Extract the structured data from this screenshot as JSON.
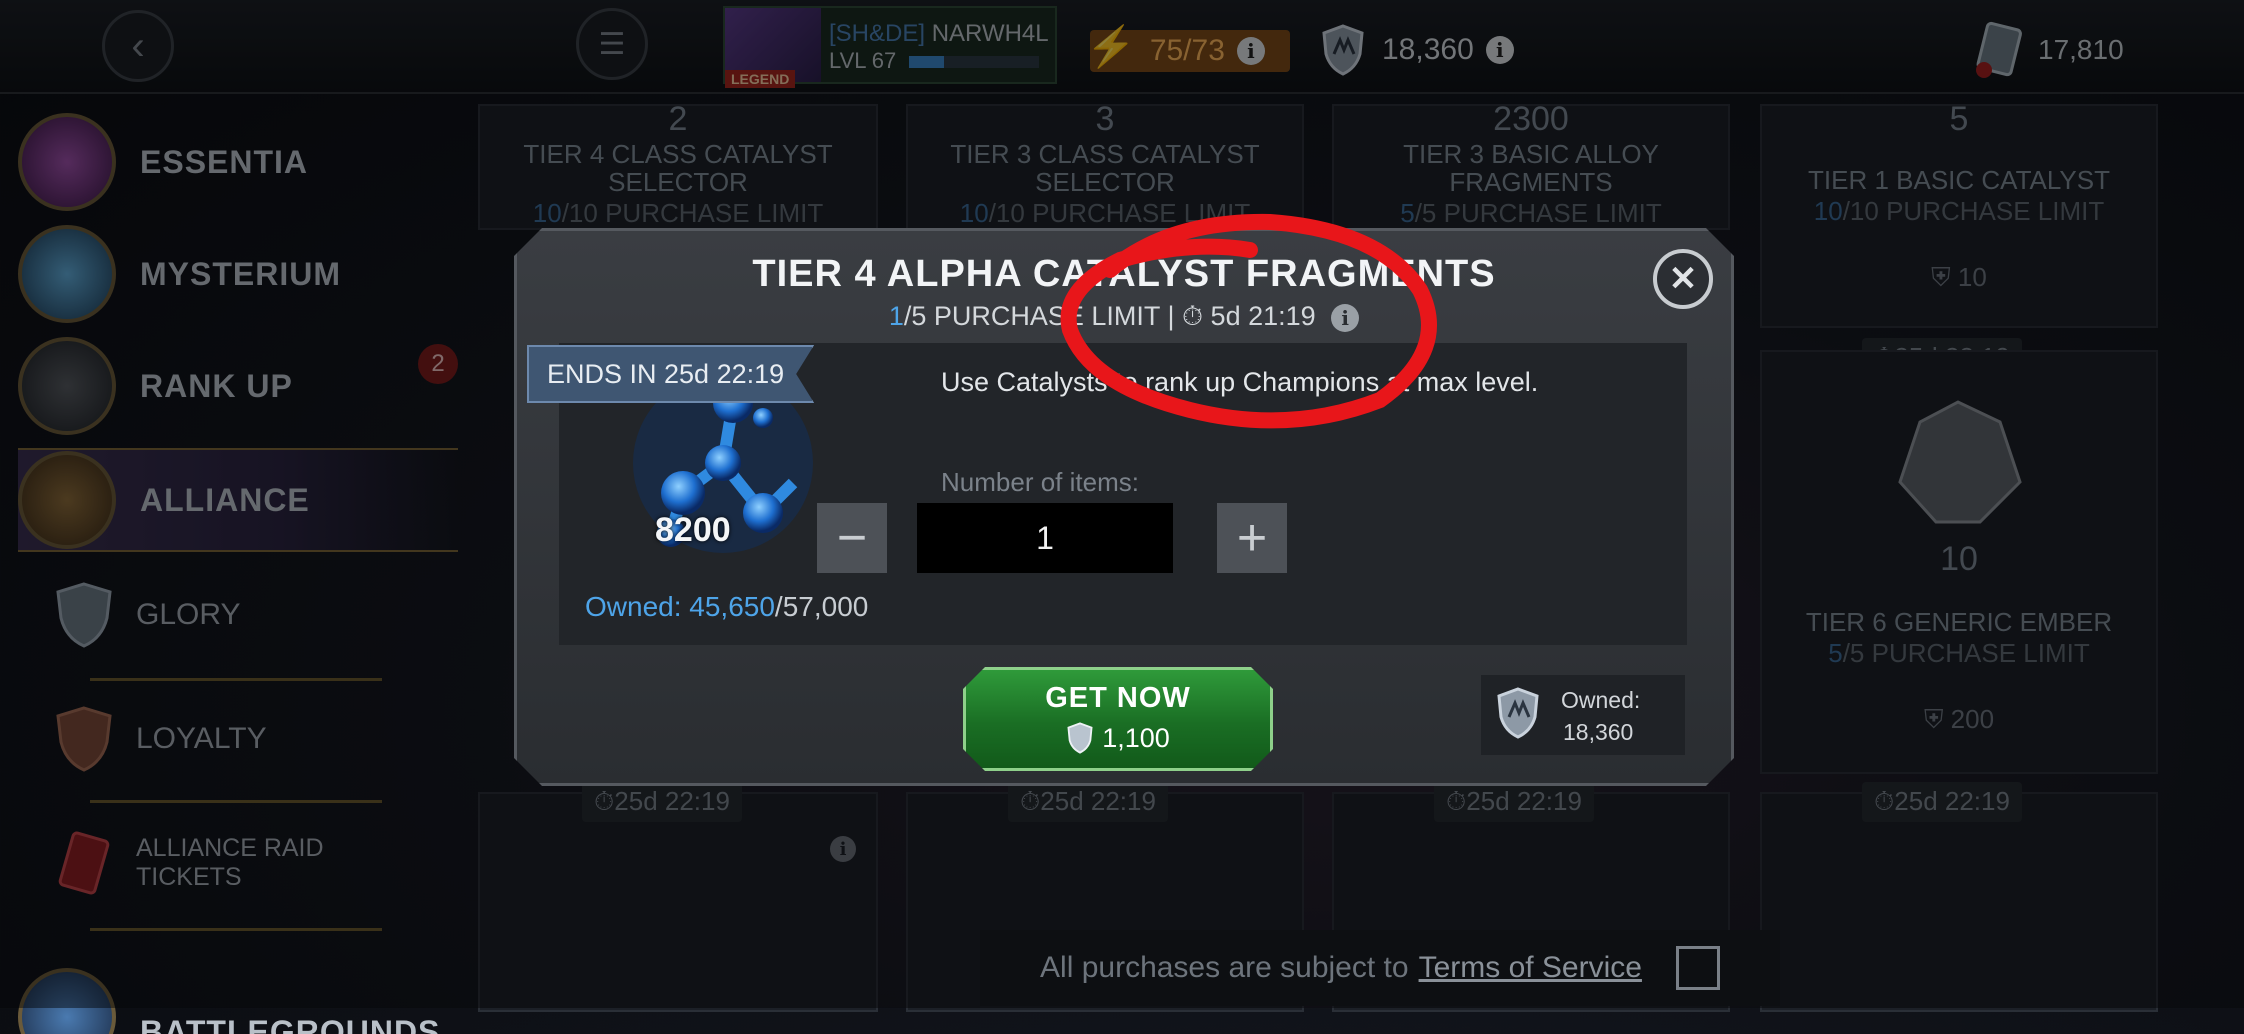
{
  "topbar": {
    "player_tag": "[SH&DE]",
    "player_name": "NARWH4L",
    "player_level": "LVL 67",
    "legend_badge": "LEGEND",
    "xp_progress": 0.27,
    "energy": "75/73",
    "alliance_coins": "18,360",
    "gold": "17,810",
    "icons": [
      "back-arrow-icon",
      "menu-icon",
      "energy-bolt-icon",
      "info-icon",
      "alliance-coin-icon",
      "gold-icon"
    ]
  },
  "sidebar": {
    "items": [
      {
        "label": "ESSENTIA"
      },
      {
        "label": "MYSTERIUM"
      },
      {
        "label": "RANK UP"
      },
      {
        "label": "ALLIANCE"
      }
    ],
    "sub_items": [
      {
        "label": "GLORY"
      },
      {
        "label": "LOYALTY"
      },
      {
        "label": "ALLIANCE RAID TICKETS"
      }
    ],
    "bottom_item": "BATTLEGROUNDS",
    "rank_up_badge": "2"
  },
  "cards": [
    {
      "count": "2",
      "title_1": "TIER 4 CLASS CATALYST",
      "title_2": "SELECTOR",
      "limit_cur": "10",
      "limit_rest": "/10 PURCHASE LIMIT"
    },
    {
      "count": "3",
      "title_1": "TIER 3 CLASS CATALYST",
      "title_2": "SELECTOR",
      "limit_cur": "10",
      "limit_rest": "/10 PURCHASE LIMIT"
    },
    {
      "count": "2300",
      "title_1": "TIER 3 BASIC ALLOY",
      "title_2": "FRAGMENTS",
      "limit_cur": "5",
      "limit_rest": "/5 PURCHASE LIMIT"
    },
    {
      "count": "5",
      "title_1": "TIER 1 BASIC CATALYST",
      "limit_cur": "10",
      "limit_rest": "/10 PURCHASE LIMIT",
      "price": "10"
    },
    {
      "count": "10",
      "title_1": "TIER 6 GENERIC EMBER",
      "limit_cur": "5",
      "limit_rest": "/5 PURCHASE LIMIT",
      "price": "200"
    }
  ],
  "timers": [
    "25d 22:19",
    "25d 22:19",
    "25d 22:19",
    "25d 22:19",
    "25d 22:19"
  ],
  "modal": {
    "title": "TIER 4 ALPHA CATALYST FRAGMENTS",
    "limit_cur": "1",
    "limit_rest": "/5 PURCHASE LIMIT",
    "separator": "|",
    "timer": "5d 21:19",
    "ends_in": "ENDS IN 25d 22:19",
    "item_qty": "8200",
    "owned_label": "Owned: ",
    "owned_cur": "45,650",
    "owned_max": "/57,000",
    "description": "Use Catalysts to rank up Champions at max level.",
    "number_label": "Number of items:",
    "quantity": "1",
    "minus": "−",
    "plus": "+",
    "get_now": "GET NOW",
    "price": "1,100",
    "wallet_label": "Owned:",
    "wallet_value": "18,360",
    "close": "✕"
  },
  "footer": {
    "text": "All purchases are subject to",
    "link": "Terms of Service"
  },
  "colors": {
    "accent_blue": "#4ea4e8",
    "get_now_green": "#1a6e24",
    "annotation_red": "#e8161a"
  }
}
